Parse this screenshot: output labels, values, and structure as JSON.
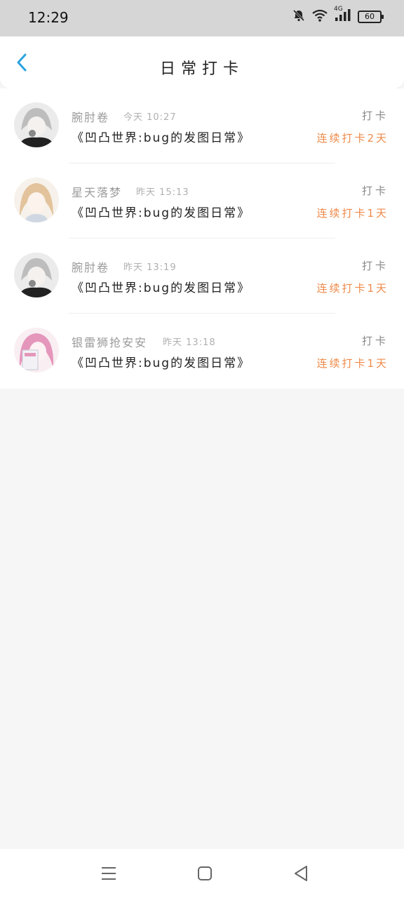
{
  "status_bar": {
    "time": "12:29",
    "network": "4G",
    "battery": "60",
    "icons": [
      "mute-bell-icon",
      "wifi-icon",
      "signal-icon",
      "battery-icon"
    ]
  },
  "header": {
    "title": "日常打卡",
    "back_icon": "chevron-left-icon"
  },
  "entries": [
    {
      "name": "腕肘卷",
      "time": "今天 10:27",
      "title": "《凹凸世界:bug的发图日常》",
      "action": "打卡",
      "streak": "连续打卡2天",
      "avatar_colors": [
        "#e9e9e9",
        "#2a2a2a"
      ]
    },
    {
      "name": "星天落梦",
      "time": "昨天 15:13",
      "title": "《凹凸世界:bug的发图日常》",
      "action": "打卡",
      "streak": "连续打卡1天",
      "avatar_colors": [
        "#f6efe6",
        "#d7b48f"
      ]
    },
    {
      "name": "腕肘卷",
      "time": "昨天 13:19",
      "title": "《凹凸世界:bug的发图日常》",
      "action": "打卡",
      "streak": "连续打卡1天",
      "avatar_colors": [
        "#e9e9e9",
        "#2a2a2a"
      ]
    },
    {
      "name": "银雷狮抢安安",
      "time": "昨天 13:18",
      "title": "《凹凸世界:bug的发图日常》",
      "action": "打卡",
      "streak": "连续打卡1天",
      "avatar_colors": [
        "#f7dbe4",
        "#d98ab0"
      ]
    }
  ],
  "colors": {
    "accent_blue": "#2aa3e0",
    "streak_orange": "#ef8a4a",
    "status_bar_bg": "#d6d6d6",
    "page_bg": "#f7f6f7"
  },
  "nav_bar": {
    "icons": [
      "menu-icon",
      "home-icon",
      "back-triangle-icon"
    ]
  }
}
